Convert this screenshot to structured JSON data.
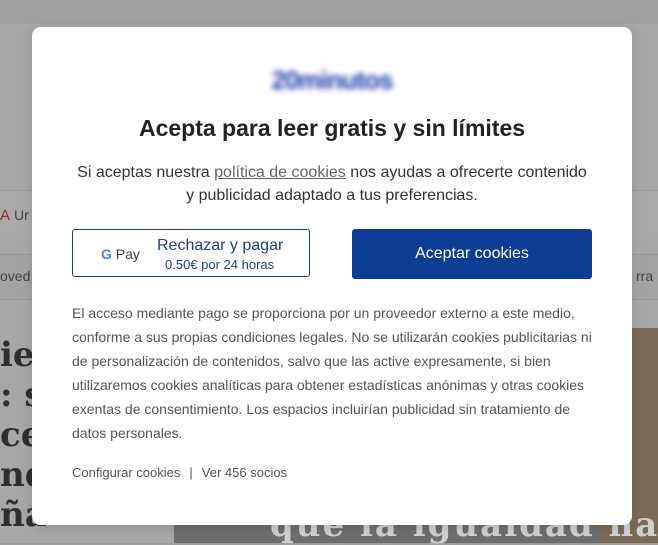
{
  "background": {
    "nav_partial_1": "Ur",
    "nav_partial_2": "oved",
    "nav_partial_3": "rra",
    "headline_partial": "ier\n: s\ncep\nnd\nña",
    "photo_caption_partial": "que la igualdad ha i"
  },
  "modal": {
    "logo_text": "20minutos",
    "title": "Acepta para leer gratis y sin límites",
    "desc_prefix": "Si aceptas nuestra ",
    "desc_link": "política de cookies",
    "desc_suffix": " nos ayudas a ofrecerte contenido y publicidad adaptado a tus preferencias.",
    "reject_button": {
      "gpay_g": "G",
      "gpay_label": "Pay",
      "label": "Rechazar y pagar",
      "price": "0.50€ por 24 horas"
    },
    "accept_button": "Aceptar cookies",
    "legal_text": "El acceso mediante pago se proporciona por un proveedor externo a este medio, conforme a sus propias condiciones legales. No se utilizarán cookies publicitarias ni de personalización de contenidos, salvo que las active expresamente, si bien utilizaremos cookies analíticas para obtener estadísticas anónimas y otras cookies exentas de consentimiento. Los espacios incluirían publicidad sin tratamiento de datos personales.",
    "footer": {
      "configure": "Configurar cookies",
      "separator": "|",
      "partners": "Ver 456 socios"
    }
  }
}
